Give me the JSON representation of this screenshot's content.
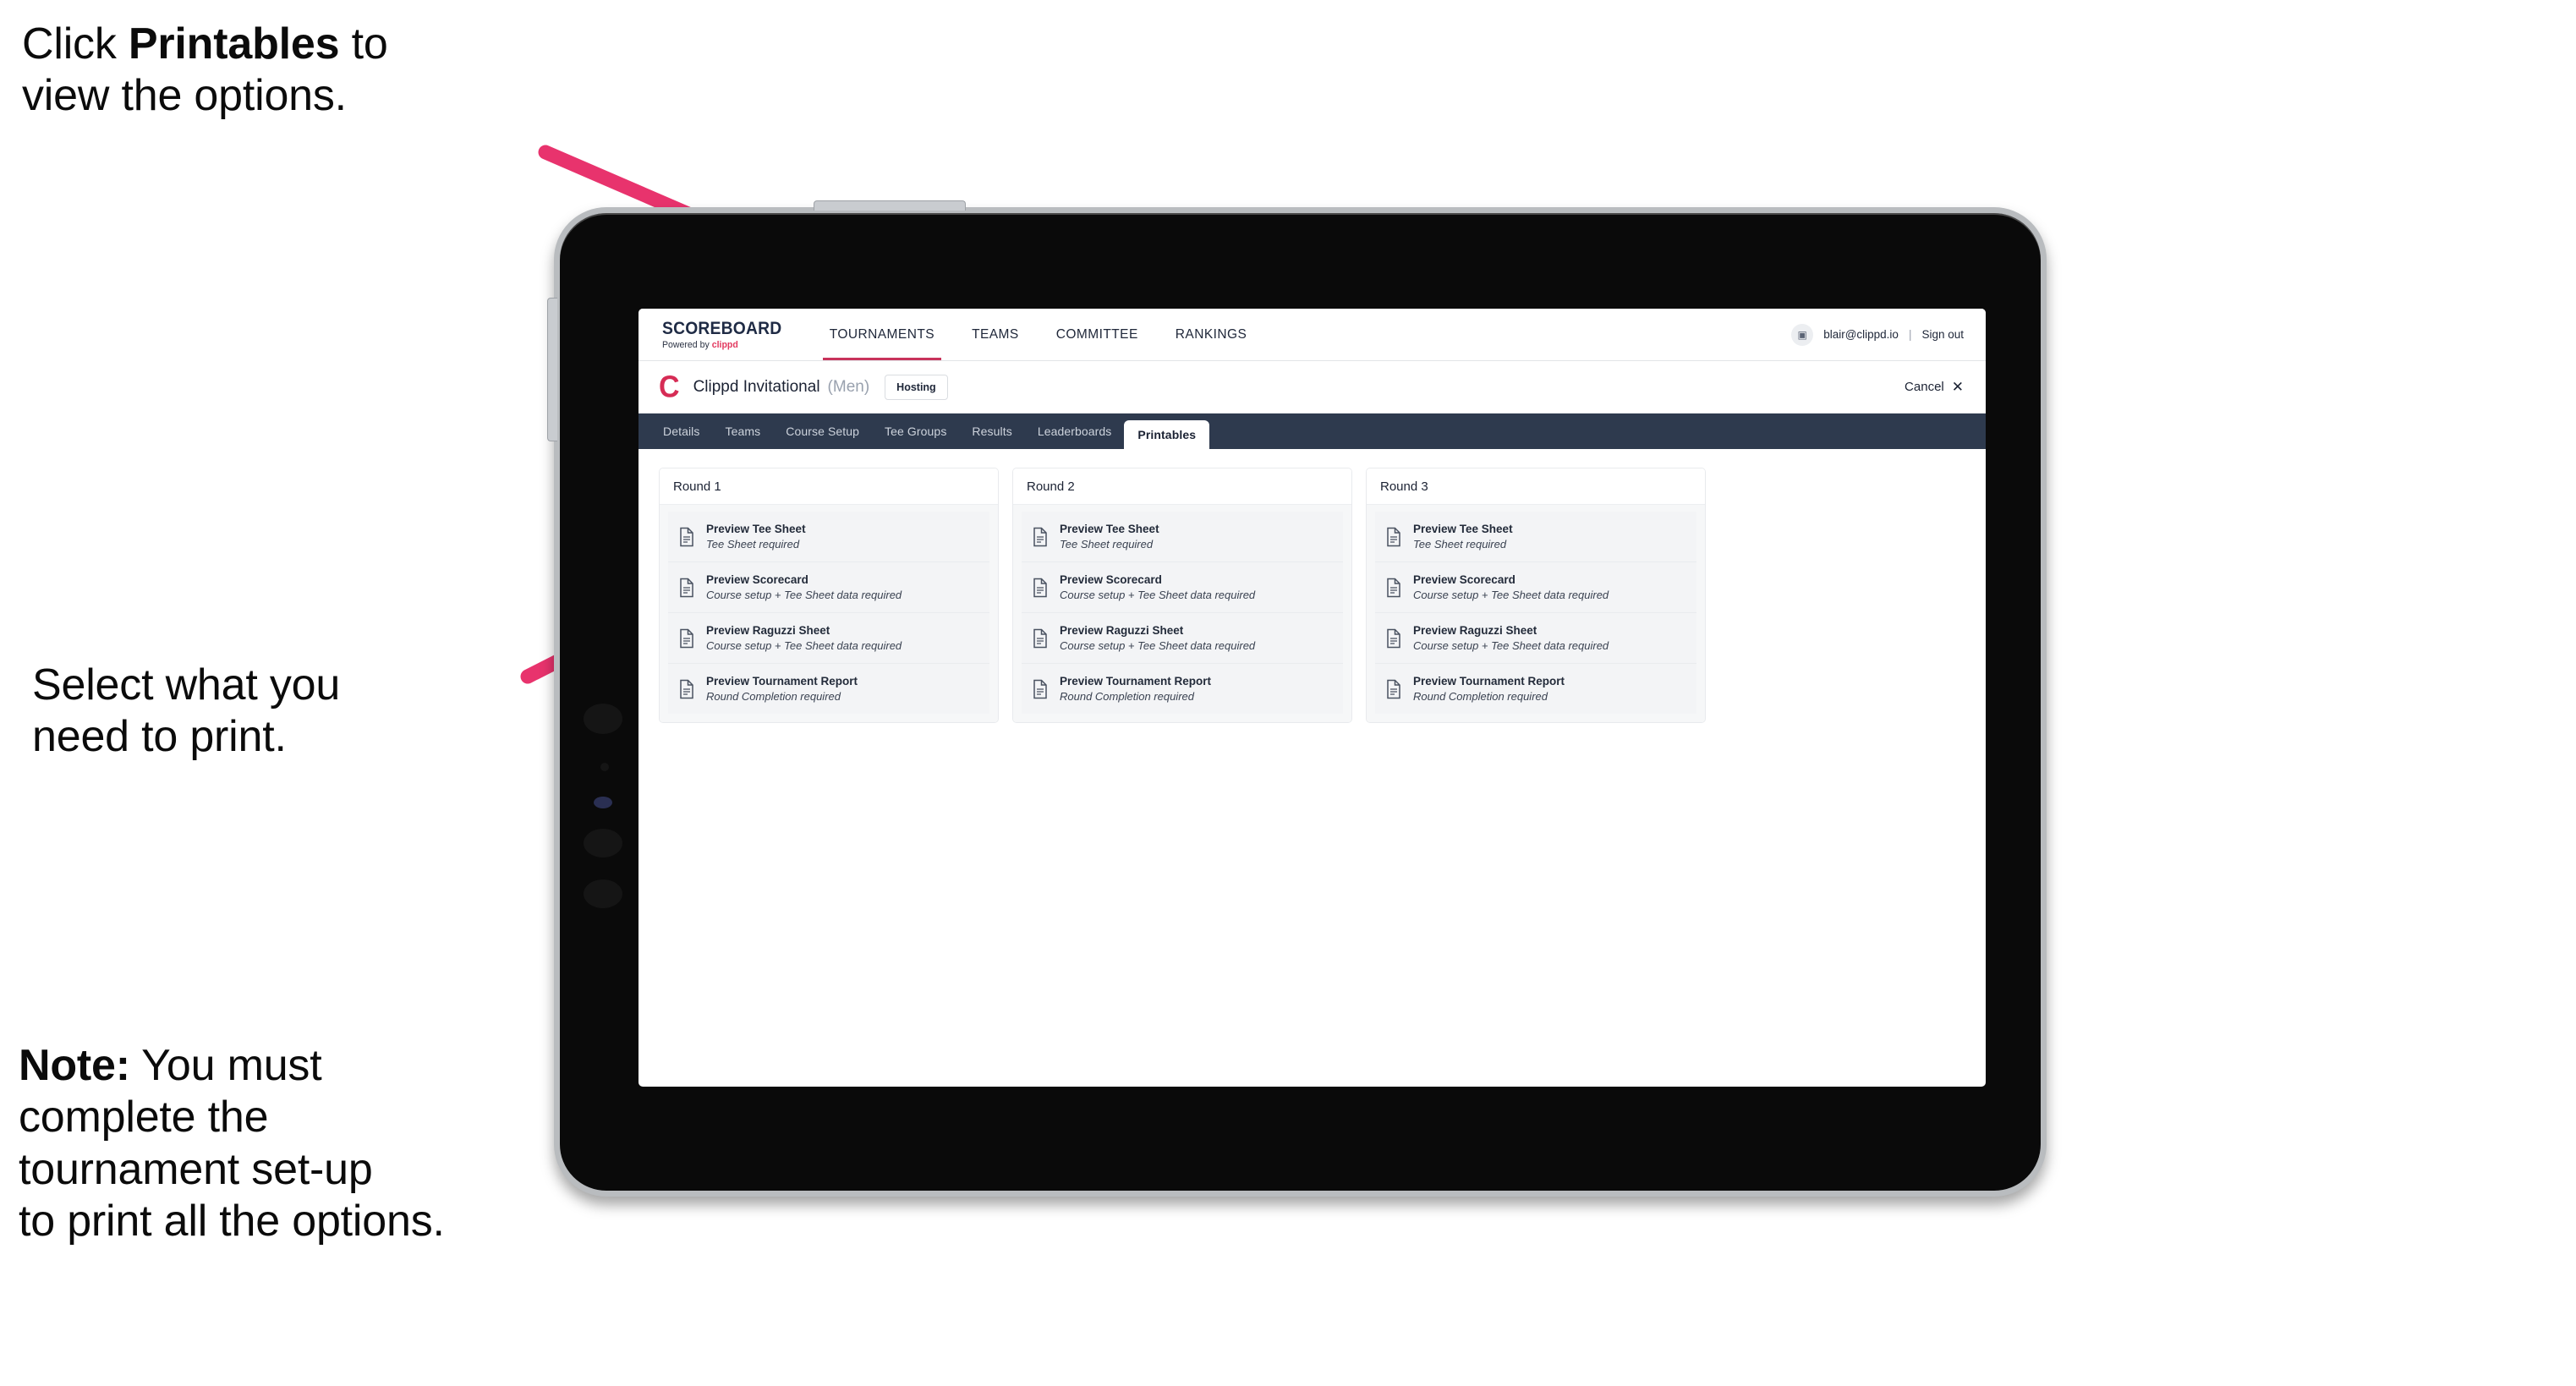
{
  "annotations": {
    "click_printables": {
      "pre": "Click ",
      "bold": "Printables",
      "post": " to\nview the options."
    },
    "select_print": "Select what you\n need to print.",
    "note": {
      "bold": "Note:",
      "rest": " You must\ncomplete the\ntournament set-up\nto print all the options."
    }
  },
  "colors": {
    "arrow_pink": "#e8336d",
    "navbar_dark": "#2e3a4e",
    "brand_pink": "#e2395f",
    "accent_underline": "#c8335b"
  },
  "app": {
    "brand": {
      "name": "SCOREBOARD",
      "powered_prefix": "Powered by ",
      "powered_brand": "clippd"
    },
    "top_nav": [
      {
        "label": "TOURNAMENTS",
        "active": true
      },
      {
        "label": "TEAMS",
        "active": false
      },
      {
        "label": "COMMITTEE",
        "active": false
      },
      {
        "label": "RANKINGS",
        "active": false
      }
    ],
    "user": {
      "avatar_glyph": "▣",
      "email": "blair@clippd.io",
      "separator": "|",
      "sign_out": "Sign out"
    },
    "tournament": {
      "logo_letter": "C",
      "name": "Clippd Invitational",
      "gender": "(Men)",
      "badge": "Hosting",
      "cancel_label": "Cancel",
      "cancel_icon": "✕"
    },
    "section_tabs": [
      {
        "label": "Details",
        "active": false
      },
      {
        "label": "Teams",
        "active": false
      },
      {
        "label": "Course Setup",
        "active": false
      },
      {
        "label": "Tee Groups",
        "active": false
      },
      {
        "label": "Results",
        "active": false
      },
      {
        "label": "Leaderboards",
        "active": false
      },
      {
        "label": "Printables",
        "active": true
      }
    ],
    "rounds": [
      {
        "title": "Round 1",
        "items": [
          {
            "title": "Preview Tee Sheet",
            "sub": "Tee Sheet required"
          },
          {
            "title": "Preview Scorecard",
            "sub": "Course setup + Tee Sheet data required"
          },
          {
            "title": "Preview Raguzzi Sheet",
            "sub": "Course setup + Tee Sheet data required"
          },
          {
            "title": "Preview Tournament Report",
            "sub": "Round Completion required"
          }
        ]
      },
      {
        "title": "Round 2",
        "items": [
          {
            "title": "Preview Tee Sheet",
            "sub": "Tee Sheet required"
          },
          {
            "title": "Preview Scorecard",
            "sub": "Course setup + Tee Sheet data required"
          },
          {
            "title": "Preview Raguzzi Sheet",
            "sub": "Course setup + Tee Sheet data required"
          },
          {
            "title": "Preview Tournament Report",
            "sub": "Round Completion required"
          }
        ]
      },
      {
        "title": "Round 3",
        "items": [
          {
            "title": "Preview Tee Sheet",
            "sub": "Tee Sheet required"
          },
          {
            "title": "Preview Scorecard",
            "sub": "Course setup + Tee Sheet data required"
          },
          {
            "title": "Preview Raguzzi Sheet",
            "sub": "Course setup + Tee Sheet data required"
          },
          {
            "title": "Preview Tournament Report",
            "sub": "Round Completion required"
          }
        ]
      }
    ]
  }
}
